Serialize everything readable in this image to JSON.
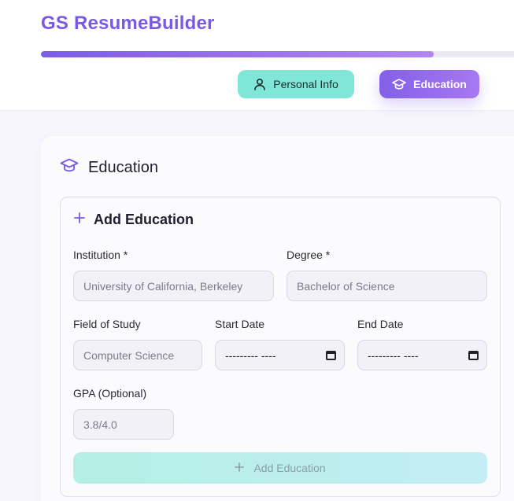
{
  "app": {
    "title": "GS ResumeBuilder"
  },
  "progress": {
    "fraction": 0.83
  },
  "steps": [
    {
      "label": "Personal Info",
      "icon": "user-icon",
      "state": "completed"
    },
    {
      "label": "Education",
      "icon": "graduation-cap-icon",
      "state": "active"
    }
  ],
  "section": {
    "title": "Education",
    "icon": "graduation-cap-icon"
  },
  "form": {
    "title": "Add Education",
    "institution": {
      "label": "Institution *",
      "placeholder": "University of California, Berkeley"
    },
    "degree": {
      "label": "Degree *",
      "placeholder": "Bachelor of Science"
    },
    "field_of_study": {
      "label": "Field of Study",
      "placeholder": "Computer Science"
    },
    "start_date": {
      "label": "Start Date",
      "value": "--------- ----"
    },
    "end_date": {
      "label": "End Date",
      "value": "--------- ----"
    },
    "gpa": {
      "label": "GPA (Optional)",
      "placeholder": "3.8/4.0"
    },
    "submit_label": "Add Education"
  },
  "colors": {
    "accent": "#7a5ae0",
    "teal": "#7fe6d8"
  }
}
